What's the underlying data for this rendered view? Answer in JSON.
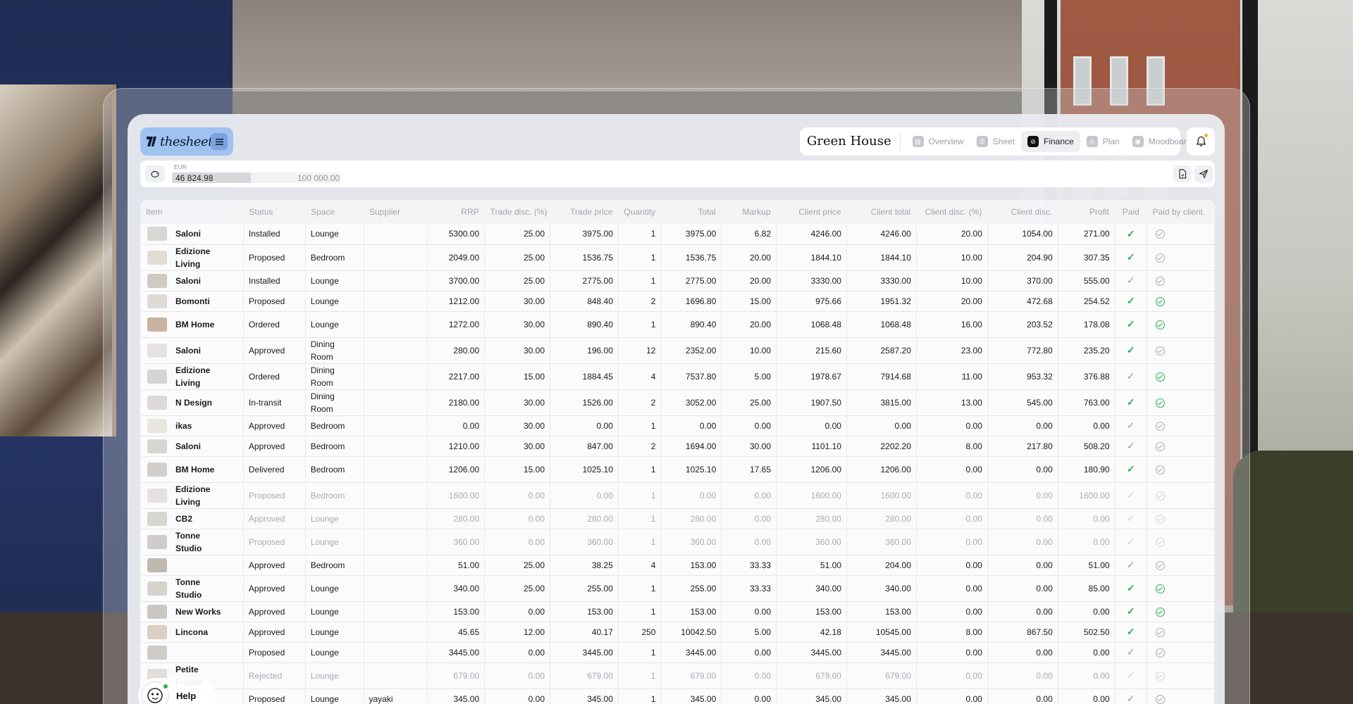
{
  "brand": {
    "name": "thesheet"
  },
  "project": {
    "title": "Green House"
  },
  "nav": {
    "tabs": [
      {
        "label": "Overview",
        "icon": "overview-icon",
        "active": false
      },
      {
        "label": "Sheet",
        "icon": "sheet-icon",
        "active": false
      },
      {
        "label": "Finance",
        "icon": "finance-icon",
        "active": true
      },
      {
        "label": "Plan",
        "icon": "plan-icon",
        "active": false
      },
      {
        "label": "Moodboard",
        "icon": "moodboard-icon",
        "active": false
      }
    ]
  },
  "budget": {
    "currency": "EUR",
    "spent": "46 824.98",
    "total": "100 000.00",
    "fill_fraction": 0.468
  },
  "table": {
    "columns": [
      "Item",
      "Status",
      "Space",
      "Supplier",
      "RRP",
      "Trade disc. (%)",
      "Trade price",
      "Quantity",
      "Total",
      "Markup",
      "Client price",
      "Client total",
      "Client disc. (%)",
      "Client disc.",
      "Profit",
      "Paid",
      "Paid by client."
    ],
    "rows": [
      {
        "item": "Saloni",
        "status": "Installed",
        "space": "Lounge",
        "supplier": "",
        "rrp": "5300.00",
        "trade_disc": "25.00",
        "trade_price": "3975.00",
        "qty": "1",
        "total": "3975.00",
        "markup": "6.82",
        "client_price": "4246.00",
        "client_total": "4246.00",
        "client_disc_pct": "20.00",
        "client_disc": "1054.00",
        "profit": "271.00",
        "paid": "green",
        "paid_client": "grey",
        "dim": false
      },
      {
        "item": "Edizione Living",
        "status": "Proposed",
        "space": "Bedroom",
        "supplier": "",
        "rrp": "2049.00",
        "trade_disc": "25.00",
        "trade_price": "1536.75",
        "qty": "1",
        "total": "1536.75",
        "markup": "20.00",
        "client_price": "1844.10",
        "client_total": "1844.10",
        "client_disc_pct": "10.00",
        "client_disc": "204.90",
        "profit": "307.35",
        "paid": "green",
        "paid_client": "grey",
        "dim": false
      },
      {
        "item": "Saloni",
        "status": "Installed",
        "space": "Lounge",
        "supplier": "",
        "rrp": "3700.00",
        "trade_disc": "25.00",
        "trade_price": "2775.00",
        "qty": "1",
        "total": "2775.00",
        "markup": "20.00",
        "client_price": "3330.00",
        "client_total": "3330.00",
        "client_disc_pct": "10.00",
        "client_disc": "370.00",
        "profit": "555.00",
        "paid": "grey",
        "paid_client": "grey",
        "dim": false
      },
      {
        "item": "Bomonti",
        "status": "Proposed",
        "space": "Lounge",
        "supplier": "",
        "rrp": "1212.00",
        "trade_disc": "30.00",
        "trade_price": "848.40",
        "qty": "2",
        "total": "1696.80",
        "markup": "15.00",
        "client_price": "975.66",
        "client_total": "1951.32",
        "client_disc_pct": "20.00",
        "client_disc": "472.68",
        "profit": "254.52",
        "paid": "green",
        "paid_client": "green",
        "dim": false
      },
      {
        "item": "BM Home",
        "status": "Ordered",
        "space": "Lounge",
        "supplier": "",
        "rrp": "1272.00",
        "trade_disc": "30.00",
        "trade_price": "890.40",
        "qty": "1",
        "total": "890.40",
        "markup": "20.00",
        "client_price": "1068.48",
        "client_total": "1068.48",
        "client_disc_pct": "16.00",
        "client_disc": "203.52",
        "profit": "178.08",
        "paid": "green",
        "paid_client": "green",
        "dim": false
      },
      {
        "item": "Saloni",
        "status": "Approved",
        "space": "Dining Room",
        "supplier": "",
        "rrp": "280.00",
        "trade_disc": "30.00",
        "trade_price": "196.00",
        "qty": "12",
        "total": "2352.00",
        "markup": "10.00",
        "client_price": "215.60",
        "client_total": "2587.20",
        "client_disc_pct": "23.00",
        "client_disc": "772.80",
        "profit": "235.20",
        "paid": "green",
        "paid_client": "grey",
        "dim": false
      },
      {
        "item": "Edizione Living",
        "status": "Ordered",
        "space": "Dining Room",
        "supplier": "",
        "rrp": "2217.00",
        "trade_disc": "15.00",
        "trade_price": "1884.45",
        "qty": "4",
        "total": "7537.80",
        "markup": "5.00",
        "client_price": "1978.67",
        "client_total": "7914.68",
        "client_disc_pct": "11.00",
        "client_disc": "953.32",
        "profit": "376.88",
        "paid": "grey",
        "paid_client": "green",
        "dim": false
      },
      {
        "item": "N Design",
        "status": "In-transit",
        "space": "Dining Room",
        "supplier": "",
        "rrp": "2180.00",
        "trade_disc": "30.00",
        "trade_price": "1526.00",
        "qty": "2",
        "total": "3052.00",
        "markup": "25.00",
        "client_price": "1907.50",
        "client_total": "3815.00",
        "client_disc_pct": "13.00",
        "client_disc": "545.00",
        "profit": "763.00",
        "paid": "green",
        "paid_client": "green",
        "dim": false
      },
      {
        "item": "ikas",
        "status": "Approved",
        "space": "Bedroom",
        "supplier": "",
        "rrp": "0.00",
        "trade_disc": "30.00",
        "trade_price": "0.00",
        "qty": "1",
        "total": "0.00",
        "markup": "0.00",
        "client_price": "0.00",
        "client_total": "0.00",
        "client_disc_pct": "0.00",
        "client_disc": "0.00",
        "profit": "0.00",
        "paid": "grey",
        "paid_client": "grey",
        "dim": false
      },
      {
        "item": "Saloni",
        "status": "Approved",
        "space": "Bedroom",
        "supplier": "",
        "rrp": "1210.00",
        "trade_disc": "30.00",
        "trade_price": "847.00",
        "qty": "2",
        "total": "1694.00",
        "markup": "30.00",
        "client_price": "1101.10",
        "client_total": "2202.20",
        "client_disc_pct": "8.00",
        "client_disc": "217.80",
        "profit": "508.20",
        "paid": "grey",
        "paid_client": "grey",
        "dim": false
      },
      {
        "item": "BM Home",
        "status": "Delivered",
        "space": "Bedroom",
        "supplier": "",
        "rrp": "1206.00",
        "trade_disc": "15.00",
        "trade_price": "1025.10",
        "qty": "1",
        "total": "1025.10",
        "markup": "17.65",
        "client_price": "1206.00",
        "client_total": "1206.00",
        "client_disc_pct": "0.00",
        "client_disc": "0.00",
        "profit": "180.90",
        "paid": "green",
        "paid_client": "grey",
        "dim": false
      },
      {
        "item": "Edizione Living",
        "status": "Proposed",
        "space": "Bedroom",
        "supplier": "",
        "rrp": "1600.00",
        "trade_disc": "0.00",
        "trade_price": "0.00",
        "qty": "1",
        "total": "0.00",
        "markup": "0.00",
        "client_price": "1600.00",
        "client_total": "1600.00",
        "client_disc_pct": "0.00",
        "client_disc": "0.00",
        "profit": "1600.00",
        "paid": "faint",
        "paid_client": "faint",
        "dim": true
      },
      {
        "item": "CB2",
        "status": "Approved",
        "space": "Lounge",
        "supplier": "",
        "rrp": "280.00",
        "trade_disc": "0.00",
        "trade_price": "280.00",
        "qty": "1",
        "total": "280.00",
        "markup": "0.00",
        "client_price": "280.00",
        "client_total": "280.00",
        "client_disc_pct": "0.00",
        "client_disc": "0.00",
        "profit": "0.00",
        "paid": "faint",
        "paid_client": "faint",
        "dim": true
      },
      {
        "item": "Tonne Studio",
        "status": "Proposed",
        "space": "Lounge",
        "supplier": "",
        "rrp": "360.00",
        "trade_disc": "0.00",
        "trade_price": "360.00",
        "qty": "1",
        "total": "360.00",
        "markup": "0.00",
        "client_price": "360.00",
        "client_total": "360.00",
        "client_disc_pct": "0.00",
        "client_disc": "0.00",
        "profit": "0.00",
        "paid": "faint",
        "paid_client": "faint",
        "dim": true
      },
      {
        "item": "",
        "status": "Approved",
        "space": "Bedroom",
        "supplier": "",
        "rrp": "51.00",
        "trade_disc": "25.00",
        "trade_price": "38.25",
        "qty": "4",
        "total": "153.00",
        "markup": "33.33",
        "client_price": "51.00",
        "client_total": "204.00",
        "client_disc_pct": "0.00",
        "client_disc": "0.00",
        "profit": "51.00",
        "paid": "grey",
        "paid_client": "grey",
        "dim": false
      },
      {
        "item": "Tonne Studio",
        "status": "Approved",
        "space": "Lounge",
        "supplier": "",
        "rrp": "340.00",
        "trade_disc": "25.00",
        "trade_price": "255.00",
        "qty": "1",
        "total": "255.00",
        "markup": "33.33",
        "client_price": "340.00",
        "client_total": "340.00",
        "client_disc_pct": "0.00",
        "client_disc": "0.00",
        "profit": "85.00",
        "paid": "green",
        "paid_client": "green",
        "dim": false
      },
      {
        "item": "New Works",
        "status": "Approved",
        "space": "Lounge",
        "supplier": "",
        "rrp": "153.00",
        "trade_disc": "0.00",
        "trade_price": "153.00",
        "qty": "1",
        "total": "153.00",
        "markup": "0.00",
        "client_price": "153.00",
        "client_total": "153.00",
        "client_disc_pct": "0.00",
        "client_disc": "0.00",
        "profit": "0.00",
        "paid": "green",
        "paid_client": "green",
        "dim": false
      },
      {
        "item": "Lincona",
        "status": "Approved",
        "space": "Lounge",
        "supplier": "",
        "rrp": "45.65",
        "trade_disc": "12.00",
        "trade_price": "40.17",
        "qty": "250",
        "total": "10042.50",
        "markup": "5.00",
        "client_price": "42.18",
        "client_total": "10545.00",
        "client_disc_pct": "8.00",
        "client_disc": "867.50",
        "profit": "502.50",
        "paid": "green",
        "paid_client": "grey",
        "dim": false
      },
      {
        "item": "",
        "status": "Proposed",
        "space": "Lounge",
        "supplier": "",
        "rrp": "3445.00",
        "trade_disc": "0.00",
        "trade_price": "3445.00",
        "qty": "1",
        "total": "3445.00",
        "markup": "0.00",
        "client_price": "3445.00",
        "client_total": "3445.00",
        "client_disc_pct": "0.00",
        "client_disc": "0.00",
        "profit": "0.00",
        "paid": "grey",
        "paid_client": "grey",
        "dim": false
      },
      {
        "item": "Petite Friture",
        "status": "Rejected",
        "space": "Lounge",
        "supplier": "",
        "rrp": "679.00",
        "trade_disc": "0.00",
        "trade_price": "679.00",
        "qty": "1",
        "total": "679.00",
        "markup": "0.00",
        "client_price": "679.00",
        "client_total": "679.00",
        "client_disc_pct": "0.00",
        "client_disc": "0.00",
        "profit": "0.00",
        "paid": "faint",
        "paid_client": "faint",
        "dim": true
      },
      {
        "item": "",
        "status": "Proposed",
        "space": "Lounge",
        "supplier": "yayaki",
        "rrp": "345.00",
        "trade_disc": "0.00",
        "trade_price": "345.00",
        "qty": "1",
        "total": "345.00",
        "markup": "0.00",
        "client_price": "345.00",
        "client_total": "345.00",
        "client_disc_pct": "0.00",
        "client_disc": "0.00",
        "profit": "0.00",
        "paid": "grey",
        "paid_client": "grey",
        "dim": false
      }
    ]
  },
  "help": {
    "label": "Help"
  },
  "colors": {
    "accent": "#9fc2f0",
    "paid_green": "#27b34a",
    "muted": "#a8aab0"
  }
}
